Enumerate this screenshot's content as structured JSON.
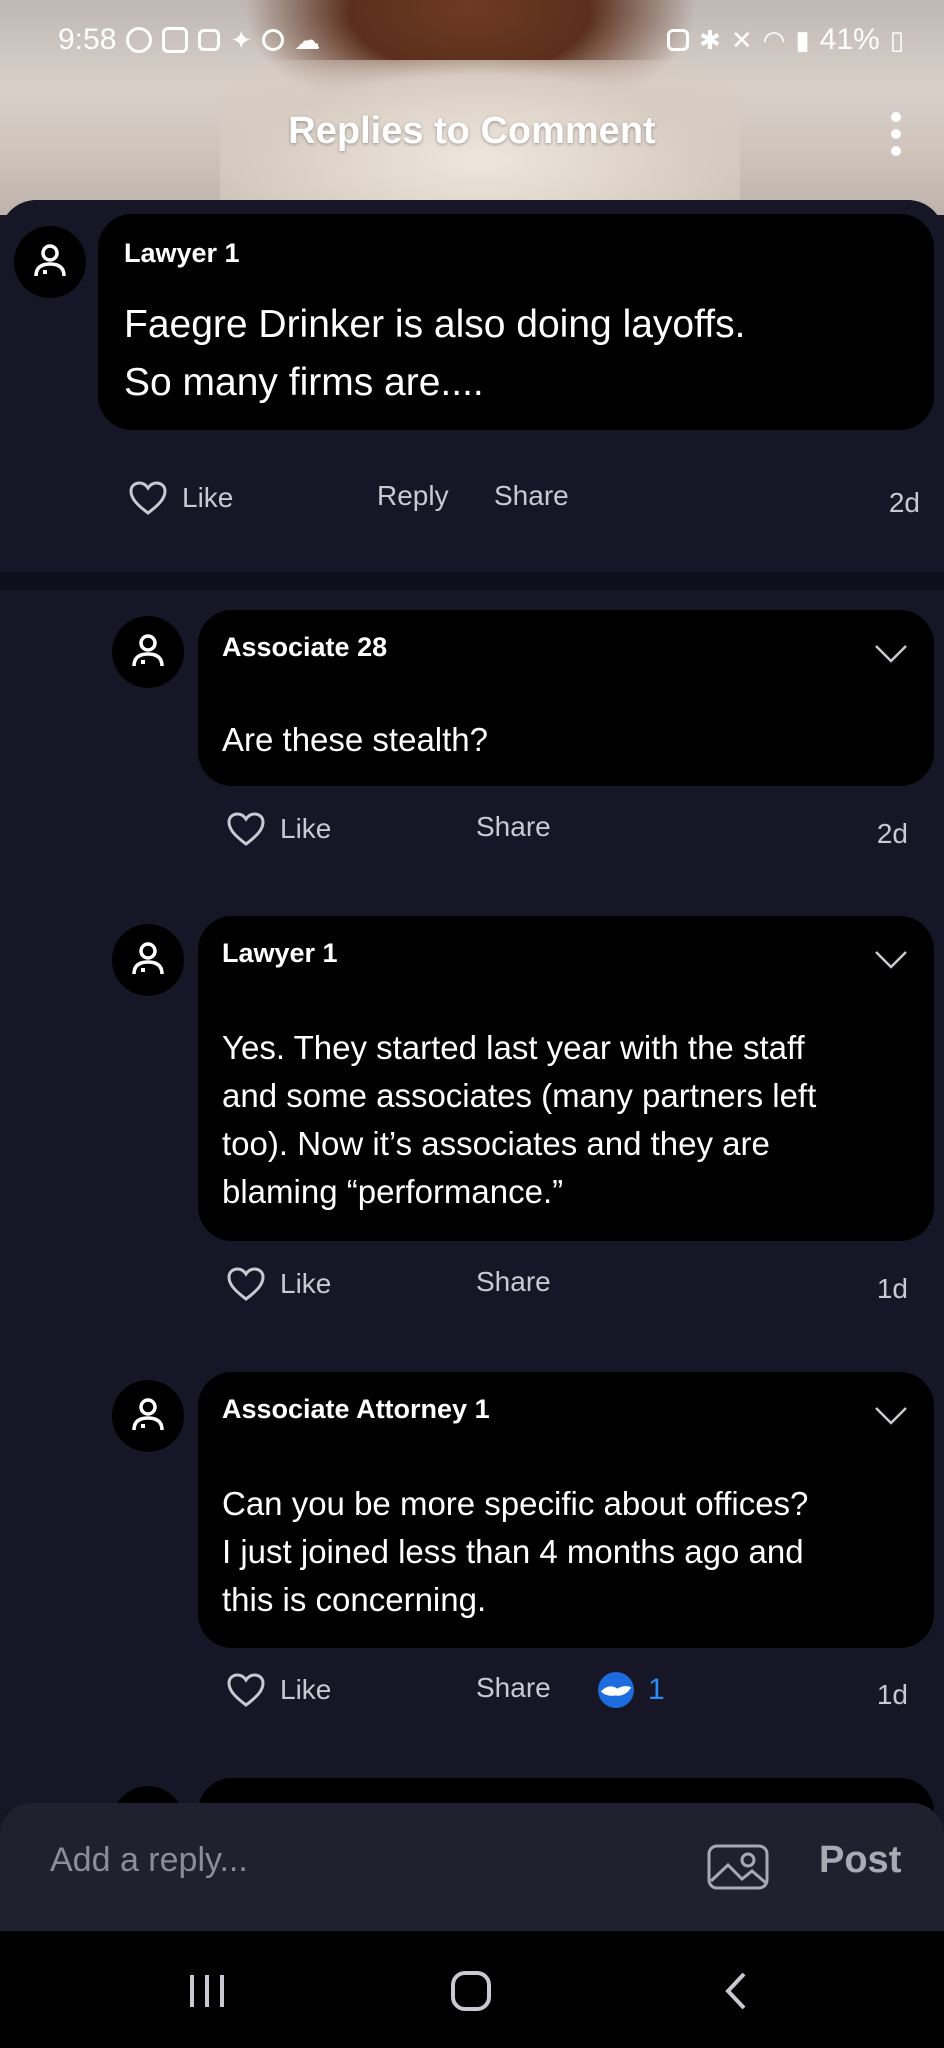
{
  "status_bar": {
    "time": "9:58",
    "battery": "41%",
    "left_icons": [
      "whatsapp-icon",
      "instagram-icon",
      "gallery-icon",
      "bird-icon",
      "camera-icon",
      "cloud-icon"
    ],
    "right_icons": [
      "lock-icon",
      "bluetooth-icon",
      "mute-icon",
      "wifi-icon",
      "signal-icon",
      "battery-icon"
    ]
  },
  "header": {
    "title": "Replies to Comment",
    "menu_icon": "more-vertical-icon"
  },
  "main_comment": {
    "author": "Lawyer 1",
    "text_line1": "Faegre Drinker is also doing layoffs.",
    "text_line2": "So many firms are....",
    "like_label": "Like",
    "reply_label": "Reply",
    "share_label": "Share",
    "time": "2d"
  },
  "replies": [
    {
      "author": "Associate 28",
      "lines": [
        "Are these stealth?"
      ],
      "like_label": "Like",
      "share_label": "Share",
      "time": "2d"
    },
    {
      "author": "Lawyer 1",
      "lines": [
        "Yes. They started last year with the staff",
        "and some associates (many partners left",
        "too). Now it’s associates and they are",
        "blaming “performance.”"
      ],
      "like_label": "Like",
      "share_label": "Share",
      "time": "1d"
    },
    {
      "author": "Associate Attorney 1",
      "lines": [
        "Can you be more specific about offices?",
        "I just joined less than 4 months ago and",
        "this is concerning."
      ],
      "like_label": "Like",
      "share_label": "Share",
      "reaction_count": "1",
      "time": "1d"
    }
  ],
  "reply_bar": {
    "placeholder": "Add a reply...",
    "post_label": "Post"
  },
  "colors": {
    "background": "#161626",
    "bubble": "#000000",
    "action_text": "#c9c9d1",
    "reaction_blue": "#1e6de0"
  }
}
